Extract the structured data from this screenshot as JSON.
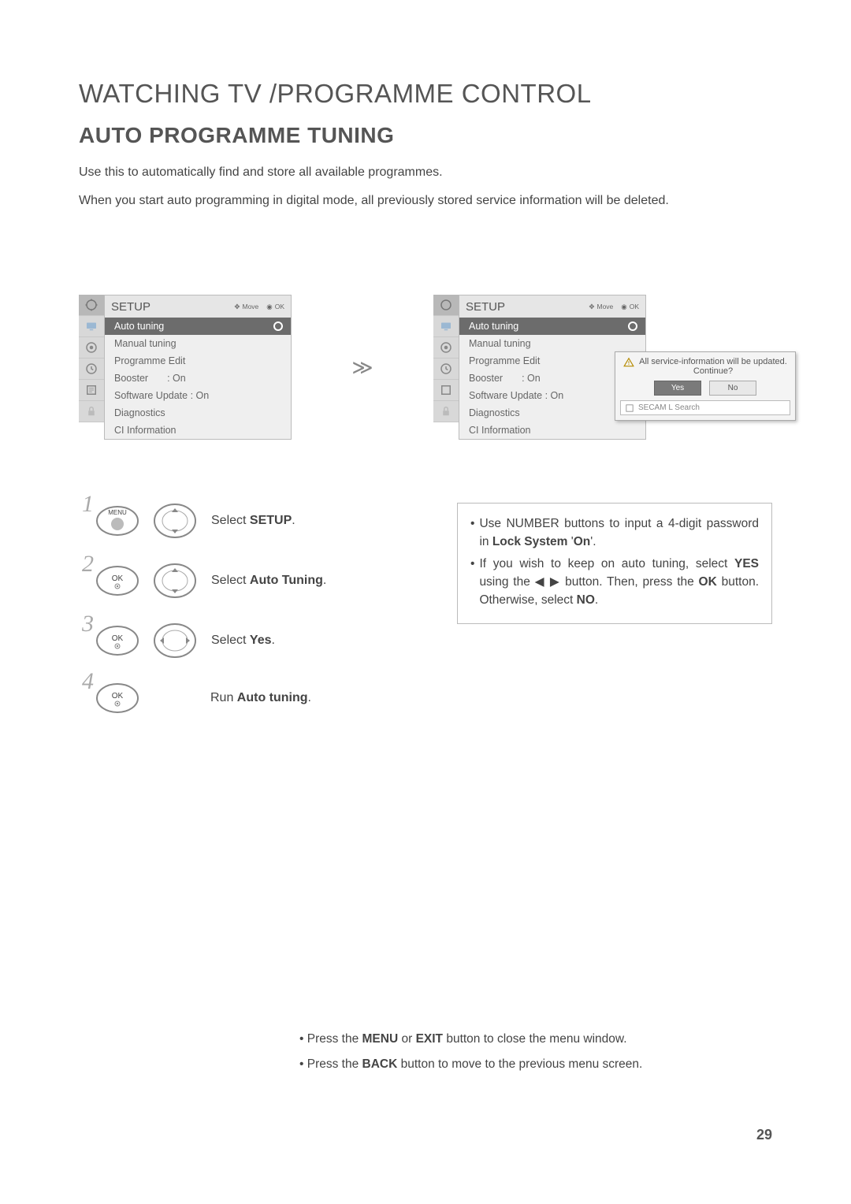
{
  "title_main": "WATCHING TV /PROGRAMME CONTROL",
  "title_sub": "AUTO PROGRAMME TUNING",
  "intro_1": "Use this to automatically find and store all available programmes.",
  "intro_2": "When you start auto programming in digital mode, all previously stored service information will be deleted.",
  "osd": {
    "header_title": "SETUP",
    "hint_move": "Move",
    "hint_ok": "OK",
    "items": {
      "auto_tuning": "Auto tuning",
      "manual_tuning": "Manual tuning",
      "programme_edit": "Programme Edit",
      "booster_label": "Booster",
      "booster_value": ": On",
      "software_update": "Software Update : On",
      "diagnostics": "Diagnostics",
      "ci_information": "CI Information"
    }
  },
  "dialog": {
    "msg_line1": "All service-information will be updated.",
    "msg_line2": "Continue?",
    "yes": "Yes",
    "no": "No",
    "search": "SECAM L Search"
  },
  "steps": {
    "s1_num": "1",
    "s1_btn_label": "MENU",
    "s1_desc_pre": "Select ",
    "s1_desc_b": "SETUP",
    "s1_desc_post": ".",
    "s2_num": "2",
    "s2_btn_label": "OK",
    "s2_desc_pre": "Select ",
    "s2_desc_b": "Auto Tuning",
    "s2_desc_post": ".",
    "s3_num": "3",
    "s3_btn_label": "OK",
    "s3_desc_pre": "Select ",
    "s3_desc_b": "Yes",
    "s3_desc_post": ".",
    "s4_num": "4",
    "s4_btn_label": "OK",
    "s4_desc_pre": "Run ",
    "s4_desc_b": "Auto tuning",
    "s4_desc_post": "."
  },
  "info": {
    "li1_a": "Use NUMBER buttons to input a 4-digit password in ",
    "li1_b": "Lock System",
    "li1_c": " '",
    "li1_d": "On",
    "li1_e": "'.",
    "li2_a": "If you wish to keep on auto tuning, select ",
    "li2_b": "YES",
    "li2_c": " using the ",
    "li2_d": " button. Then, press the ",
    "li2_e": "OK",
    "li2_f": " button. Otherwise, select ",
    "li2_g": "NO",
    "li2_h": "."
  },
  "footer": {
    "l1_a": "• Press the ",
    "l1_b": "MENU",
    "l1_c": " or ",
    "l1_d": "EXIT",
    "l1_e": " button to close the menu window.",
    "l2_a": "• Press the ",
    "l2_b": "BACK",
    "l2_c": " button to move to the previous menu screen."
  },
  "page_number": "29"
}
